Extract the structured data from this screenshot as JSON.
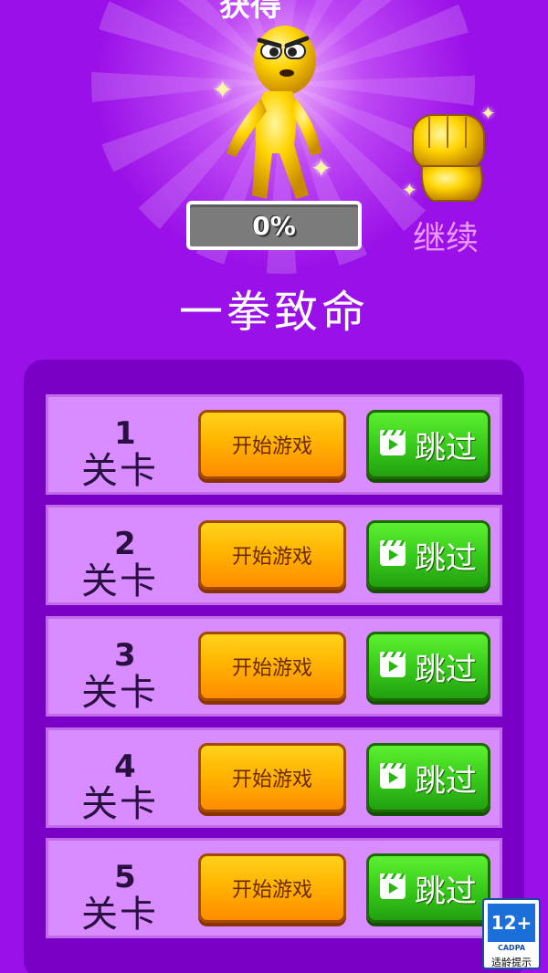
{
  "header": {
    "top_title": "获得",
    "progress_text": "0%",
    "progress_fraction": 0,
    "continue_label": "继续",
    "game_title": "一拳致命"
  },
  "levels": [
    {
      "number": "1",
      "word": "关卡",
      "start_label": "开始游戏",
      "skip_label": "跳过"
    },
    {
      "number": "2",
      "word": "关卡",
      "start_label": "开始游戏",
      "skip_label": "跳过"
    },
    {
      "number": "3",
      "word": "关卡",
      "start_label": "开始游戏",
      "skip_label": "跳过"
    },
    {
      "number": "4",
      "word": "关卡",
      "start_label": "开始游戏",
      "skip_label": "跳过"
    },
    {
      "number": "5",
      "word": "关卡",
      "start_label": "开始游戏",
      "skip_label": "跳过"
    }
  ],
  "age_badge": {
    "rating": "12+",
    "org": "CADPA",
    "hint": "适龄提示"
  },
  "colors": {
    "background": "#9a10e8",
    "panel": "#7a00c8",
    "row": "#d98cff",
    "start_button": "#ffb400",
    "skip_button": "#36c81a",
    "character": "#ffd400"
  },
  "icons": [
    "yellow-character-icon",
    "sparkle-icon",
    "fist-icon",
    "video-icon"
  ]
}
